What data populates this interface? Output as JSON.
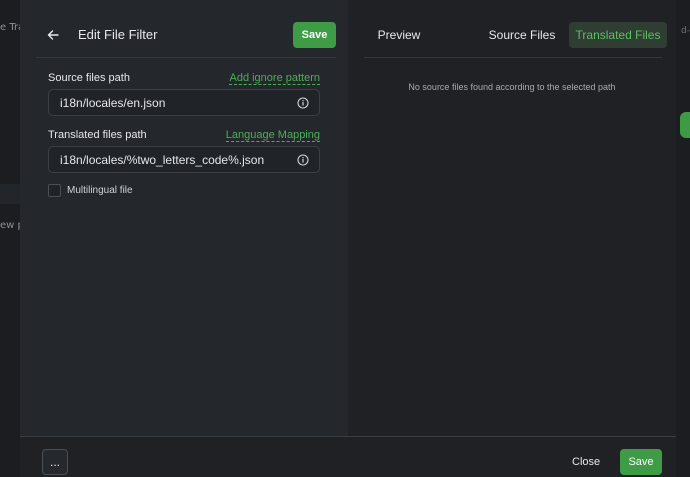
{
  "background": {
    "left_fragments": [
      "e Tra",
      "ew p"
    ],
    "right_fragment": "d-"
  },
  "colors": {
    "accent": "#3d9c45",
    "accent_text": "#4caf56",
    "active_tab_bg": "#2f3d32"
  },
  "editor": {
    "back_icon": "arrow-left-icon",
    "title": "Edit File Filter",
    "save_label": "Save",
    "source": {
      "label": "Source files path",
      "link": "Add ignore pattern",
      "value": "i18n/locales/en.json",
      "icon": "info-icon"
    },
    "translated": {
      "label": "Translated files path",
      "link": "Language Mapping",
      "value": "i18n/locales/%two_letters_code%.json",
      "icon": "info-icon"
    },
    "multilingual": {
      "label": "Multilingual file",
      "checked": false
    }
  },
  "preview": {
    "tabs": [
      {
        "label": "Preview",
        "active": false
      },
      {
        "label": "Source Files",
        "active": false
      },
      {
        "label": "Translated Files",
        "active": true
      }
    ],
    "empty_message": "No source files found according to the selected path"
  },
  "footer": {
    "more_label": "...",
    "close_label": "Close",
    "save_label": "Save"
  }
}
